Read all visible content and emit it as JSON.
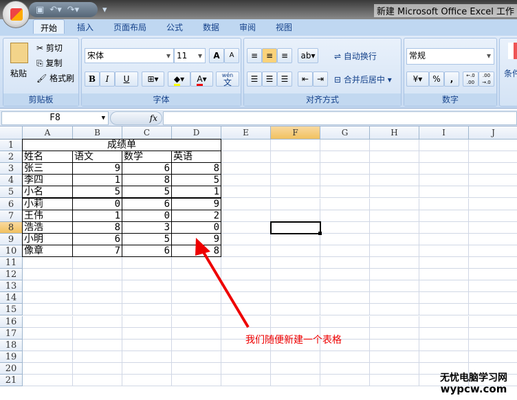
{
  "window": {
    "title": "新建 Microsoft Office Excel 工作"
  },
  "tabs": [
    "开始",
    "插入",
    "页面布局",
    "公式",
    "数据",
    "审阅",
    "视图"
  ],
  "clipboard": {
    "paste": "粘贴",
    "cut": "剪切",
    "copy": "复制",
    "format_painter": "格式刷",
    "label": "剪贴板"
  },
  "font": {
    "name": "宋体",
    "size": "11",
    "grow": "A",
    "shrink": "A",
    "bold": "B",
    "italic": "I",
    "underline": "U",
    "font_color": "A",
    "phonetic": "wén",
    "label": "字体"
  },
  "alignment": {
    "wrap": "自动换行",
    "merge": "合并后居中",
    "label": "对齐方式"
  },
  "number": {
    "format": "常规",
    "percent": "%",
    "comma": ",",
    "label": "数字",
    "inc": "←.0 .00",
    "dec": ".00 →.0"
  },
  "styles": {
    "cond": "条件"
  },
  "formula_bar": {
    "name_box": "F8",
    "fx": "fx",
    "value": ""
  },
  "columns": [
    "A",
    "B",
    "C",
    "D",
    "E",
    "F",
    "G",
    "H",
    "I",
    "J"
  ],
  "rows": [
    "1",
    "2",
    "3",
    "4",
    "5",
    "6",
    "7",
    "8",
    "9",
    "10",
    "11",
    "12",
    "13",
    "14",
    "15",
    "16",
    "17",
    "18",
    "19",
    "20",
    "21"
  ],
  "selected_cell": "F8",
  "sheet": {
    "title": "成绩单",
    "headers": [
      "姓名",
      "语文",
      "数学",
      "英语"
    ],
    "records": [
      [
        "张三",
        "9",
        "6",
        "8"
      ],
      [
        "李四",
        "1",
        "8",
        "5"
      ],
      [
        "小名",
        "5",
        "5",
        "1"
      ],
      [
        "小莉",
        "0",
        "6",
        "9"
      ],
      [
        "王伟",
        "1",
        "0",
        "2"
      ],
      [
        "浩浩",
        "8",
        "3",
        "0"
      ],
      [
        "小明",
        "6",
        "5",
        "9"
      ],
      [
        "像章",
        "7",
        "6",
        "8"
      ]
    ]
  },
  "annotation": "我们随便新建一个表格",
  "watermark": {
    "line1": "无忧电脑学习网",
    "line2": "wypcw.com"
  },
  "colors": {
    "annotation": "#ee0000",
    "selection": "#000000"
  }
}
